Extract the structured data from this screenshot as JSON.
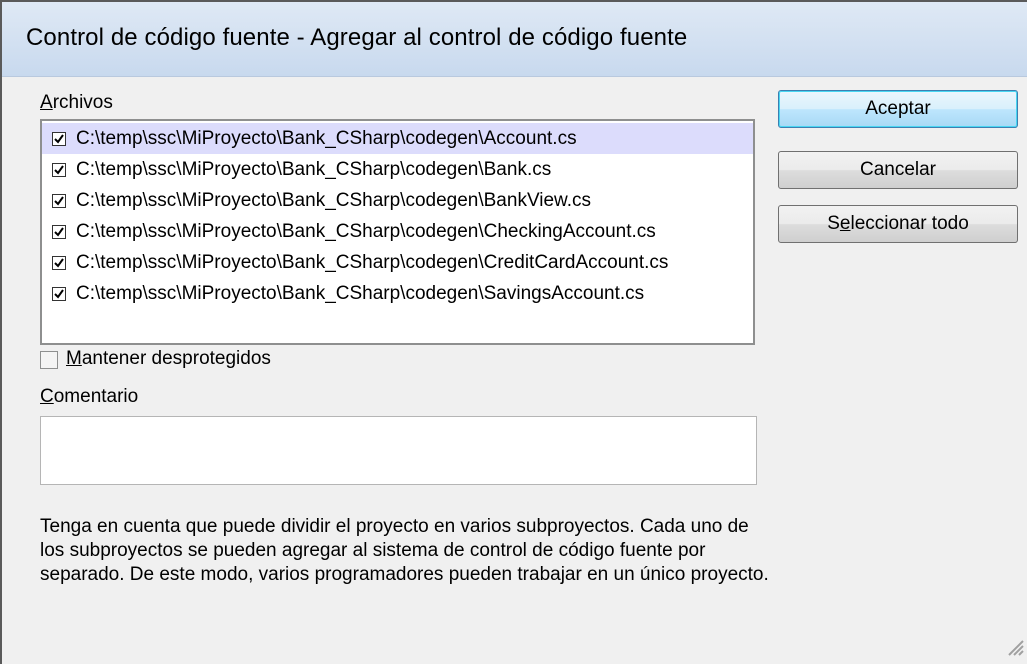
{
  "window": {
    "title": "Control de código fuente - Agregar al control de código fuente"
  },
  "files": {
    "label_mnemonic": "A",
    "label_rest": "rchivos",
    "items": [
      {
        "path": "C:\\temp\\ssc\\MiProyecto\\Bank_CSharp\\codegen\\Account.cs",
        "checked": true
      },
      {
        "path": "C:\\temp\\ssc\\MiProyecto\\Bank_CSharp\\codegen\\Bank.cs",
        "checked": true
      },
      {
        "path": "C:\\temp\\ssc\\MiProyecto\\Bank_CSharp\\codegen\\BankView.cs",
        "checked": true
      },
      {
        "path": "C:\\temp\\ssc\\MiProyecto\\Bank_CSharp\\codegen\\CheckingAccount.cs",
        "checked": true
      },
      {
        "path": "C:\\temp\\ssc\\MiProyecto\\Bank_CSharp\\codegen\\CreditCardAccount.cs",
        "checked": true
      },
      {
        "path": "C:\\temp\\ssc\\MiProyecto\\Bank_CSharp\\codegen\\SavingsAccount.cs",
        "checked": true
      }
    ]
  },
  "keep_checked_out": {
    "label_mnemonic": "M",
    "label_rest": "antener desprotegidos",
    "checked": false
  },
  "comment": {
    "label_mnemonic": "C",
    "label_rest": "omentario",
    "value": ""
  },
  "buttons": {
    "accept": "Aceptar",
    "cancel": "Cancelar",
    "select_all_pre": "S",
    "select_all_mnemonic": "e",
    "select_all_rest": "leccionar todo"
  },
  "note": "Tenga en cuenta que puede dividir el proyecto en varios subproyectos. Cada uno de los subproyectos se pueden agregar al sistema de control de código fuente por separado. De este modo, varios programadores pueden trabajar en un único proyecto."
}
